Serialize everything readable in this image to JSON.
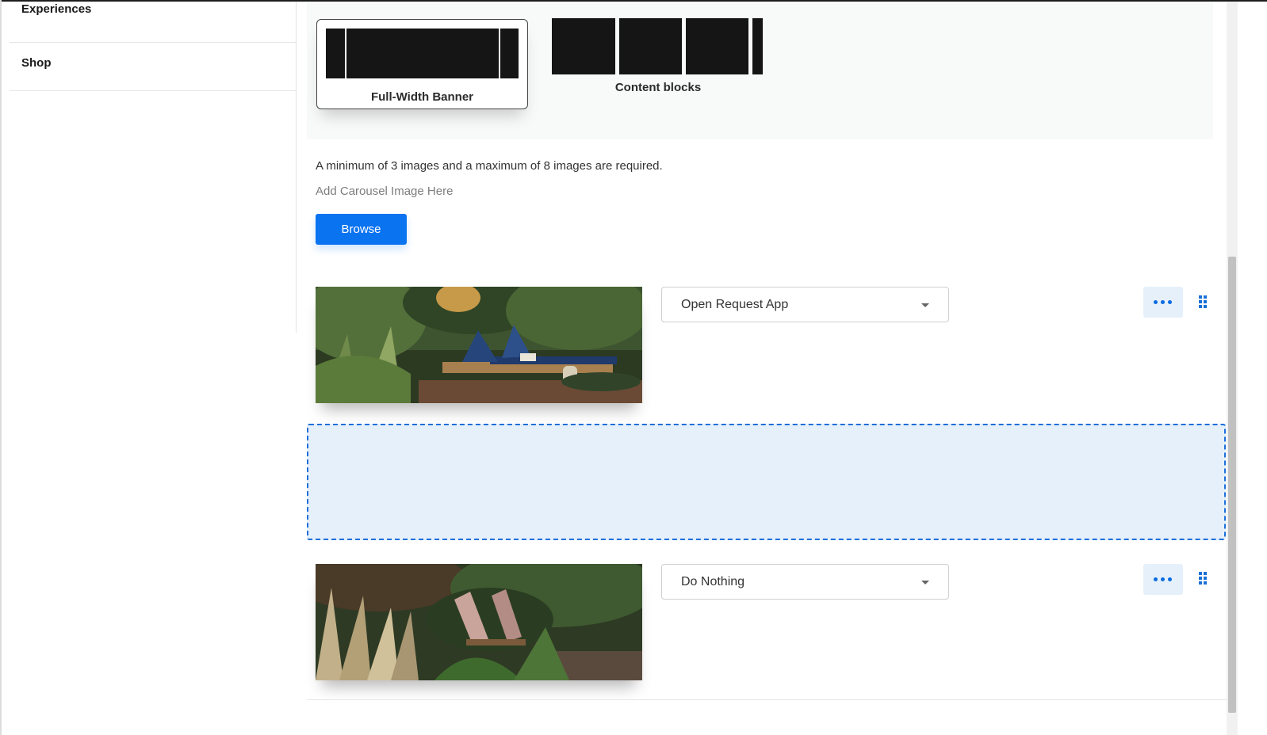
{
  "sidebar": {
    "items": [
      {
        "label": "Experiences"
      },
      {
        "label": "Shop"
      }
    ]
  },
  "layouts": {
    "full_width_banner": "Full-Width Banner",
    "content_blocks": "Content blocks",
    "selected": "Full-Width Banner"
  },
  "carousel": {
    "requirement_text": "A minimum of 3 images and a maximum of 8 images are required.",
    "add_hint": "Add Carousel Image Here",
    "browse_label": "Browse",
    "items": [
      {
        "image": "lounge chairs on deck among tropical plants",
        "action": "Open Request App"
      },
      {
        "image": "striped deck chairs among grasses and palms",
        "action": "Do Nothing"
      }
    ]
  },
  "colors": {
    "accent": "#0a73f0",
    "dropzone_bg": "#e6f0fb",
    "dropzone_border": "#1d6fd8",
    "icon_blue": "#0a6be0"
  },
  "icons": {
    "more": "more-horizontal-icon",
    "drag": "drag-handle-icon",
    "caret": "chevron-down-icon"
  }
}
